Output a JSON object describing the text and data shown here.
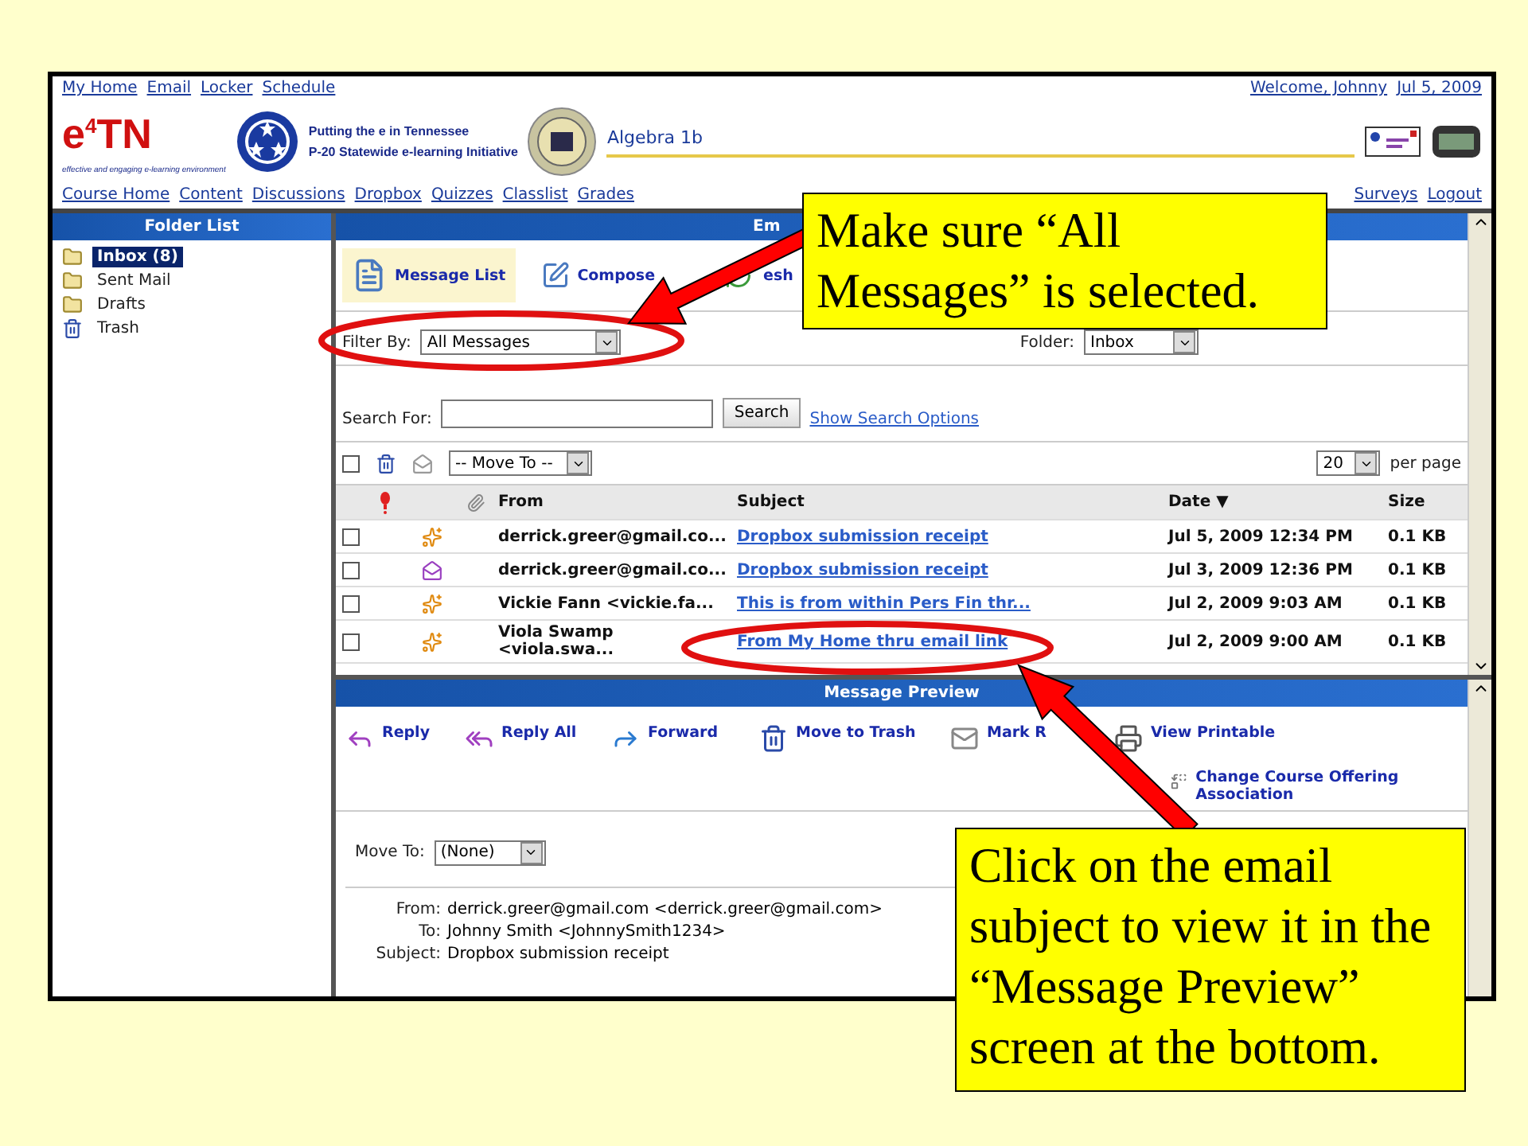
{
  "top_links": [
    "My Home",
    "Email",
    "Locker",
    "Schedule"
  ],
  "welcome": "Welcome, Johnny",
  "top_date": "Jul 5, 2009",
  "logo": {
    "mark": "e$^{4}$TN",
    "tagline": "Putting the e in Tennessee",
    "subtitle": "P-20 Statewide e-learning Initiative",
    "motto": "effective and engaging e-learning environment"
  },
  "course_title": "Algebra 1b",
  "nav": [
    "Course Home",
    "Content",
    "Discussions",
    "Dropbox",
    "Quizzes",
    "Classlist",
    "Grades"
  ],
  "nav_right": [
    "Surveys",
    "Logout"
  ],
  "folder_list": {
    "title": "Folder List",
    "items": [
      {
        "label": "Inbox (8)",
        "kind": "folder",
        "selected": true
      },
      {
        "label": "Sent Mail",
        "kind": "folder",
        "selected": false
      },
      {
        "label": "Drafts",
        "kind": "folder",
        "selected": false
      },
      {
        "label": "Trash",
        "kind": "trash",
        "selected": false
      }
    ]
  },
  "email_panel": {
    "title": "Em",
    "toolbar": [
      {
        "label": "Message List",
        "kind": "list",
        "selected": true
      },
      {
        "label": "Compose",
        "kind": "compose",
        "selected": false
      },
      {
        "label": "esh",
        "kind": "refresh",
        "selected": false
      }
    ],
    "filter": {
      "label": "Filter By:",
      "value": "All Messages"
    },
    "folder": {
      "label": "Folder:",
      "value": "Inbox"
    },
    "search": {
      "label": "Search For:",
      "button": "Search",
      "link": "Show Search Options"
    },
    "select_all_checked": false,
    "move_to": "-- Move To --",
    "per_page": {
      "value": "20",
      "label": "per page"
    },
    "columns": [
      "From",
      "Subject",
      "Date",
      "Size"
    ],
    "sort_mark": "▼",
    "rows": [
      {
        "kind": "new",
        "checked": false,
        "from": "derrick.greer@gmail.co...",
        "subject": "Dropbox submission receipt",
        "date": "Jul 5, 2009 12:34 PM",
        "size": "0.1 KB"
      },
      {
        "kind": "replied",
        "checked": false,
        "from": "derrick.greer@gmail.co...",
        "subject": "Dropbox submission receipt",
        "date": "Jul 3, 2009 12:36 PM",
        "size": "0.1 KB"
      },
      {
        "kind": "new",
        "checked": false,
        "from": "Vickie Fann <vickie.fa...",
        "subject": "This is from within Pers Fin thr...",
        "date": "Jul 2, 2009 9:03 AM",
        "size": "0.1 KB"
      },
      {
        "kind": "new",
        "checked": false,
        "from": "Viola Swamp <viola.swa...",
        "subject": "From My Home thru email link",
        "date": "Jul 2, 2009 9:00 AM",
        "size": "0.1 KB"
      }
    ]
  },
  "preview": {
    "title": "Message Preview",
    "actions": [
      {
        "label": "Reply",
        "kind": "reply"
      },
      {
        "label": "Reply All",
        "kind": "reply_all"
      },
      {
        "label": "Forward",
        "kind": "forward"
      },
      {
        "label": "Move to Trash",
        "kind": "trash"
      },
      {
        "label": "Mark R",
        "kind": "mark"
      },
      {
        "label": "View Printable",
        "kind": "print"
      },
      {
        "label": "Change Course Offering Association",
        "kind": "change"
      }
    ],
    "move_to": {
      "label": "Move To:",
      "value": "(None)"
    },
    "headers": [
      {
        "label": "From:",
        "value": "derrick.greer@gmail.com <derrick.greer@gmail.com>"
      },
      {
        "label": "To:",
        "value": "Johnny Smith <JohnnySmith1234>"
      },
      {
        "label": "Subject:",
        "value": "Dropbox submission receipt"
      }
    ]
  },
  "callouts": [
    {
      "text": "Make sure “All Messages” is selected."
    },
    {
      "text": "Click on the email subject to view it in the “Message Preview” screen at the bottom."
    }
  ]
}
